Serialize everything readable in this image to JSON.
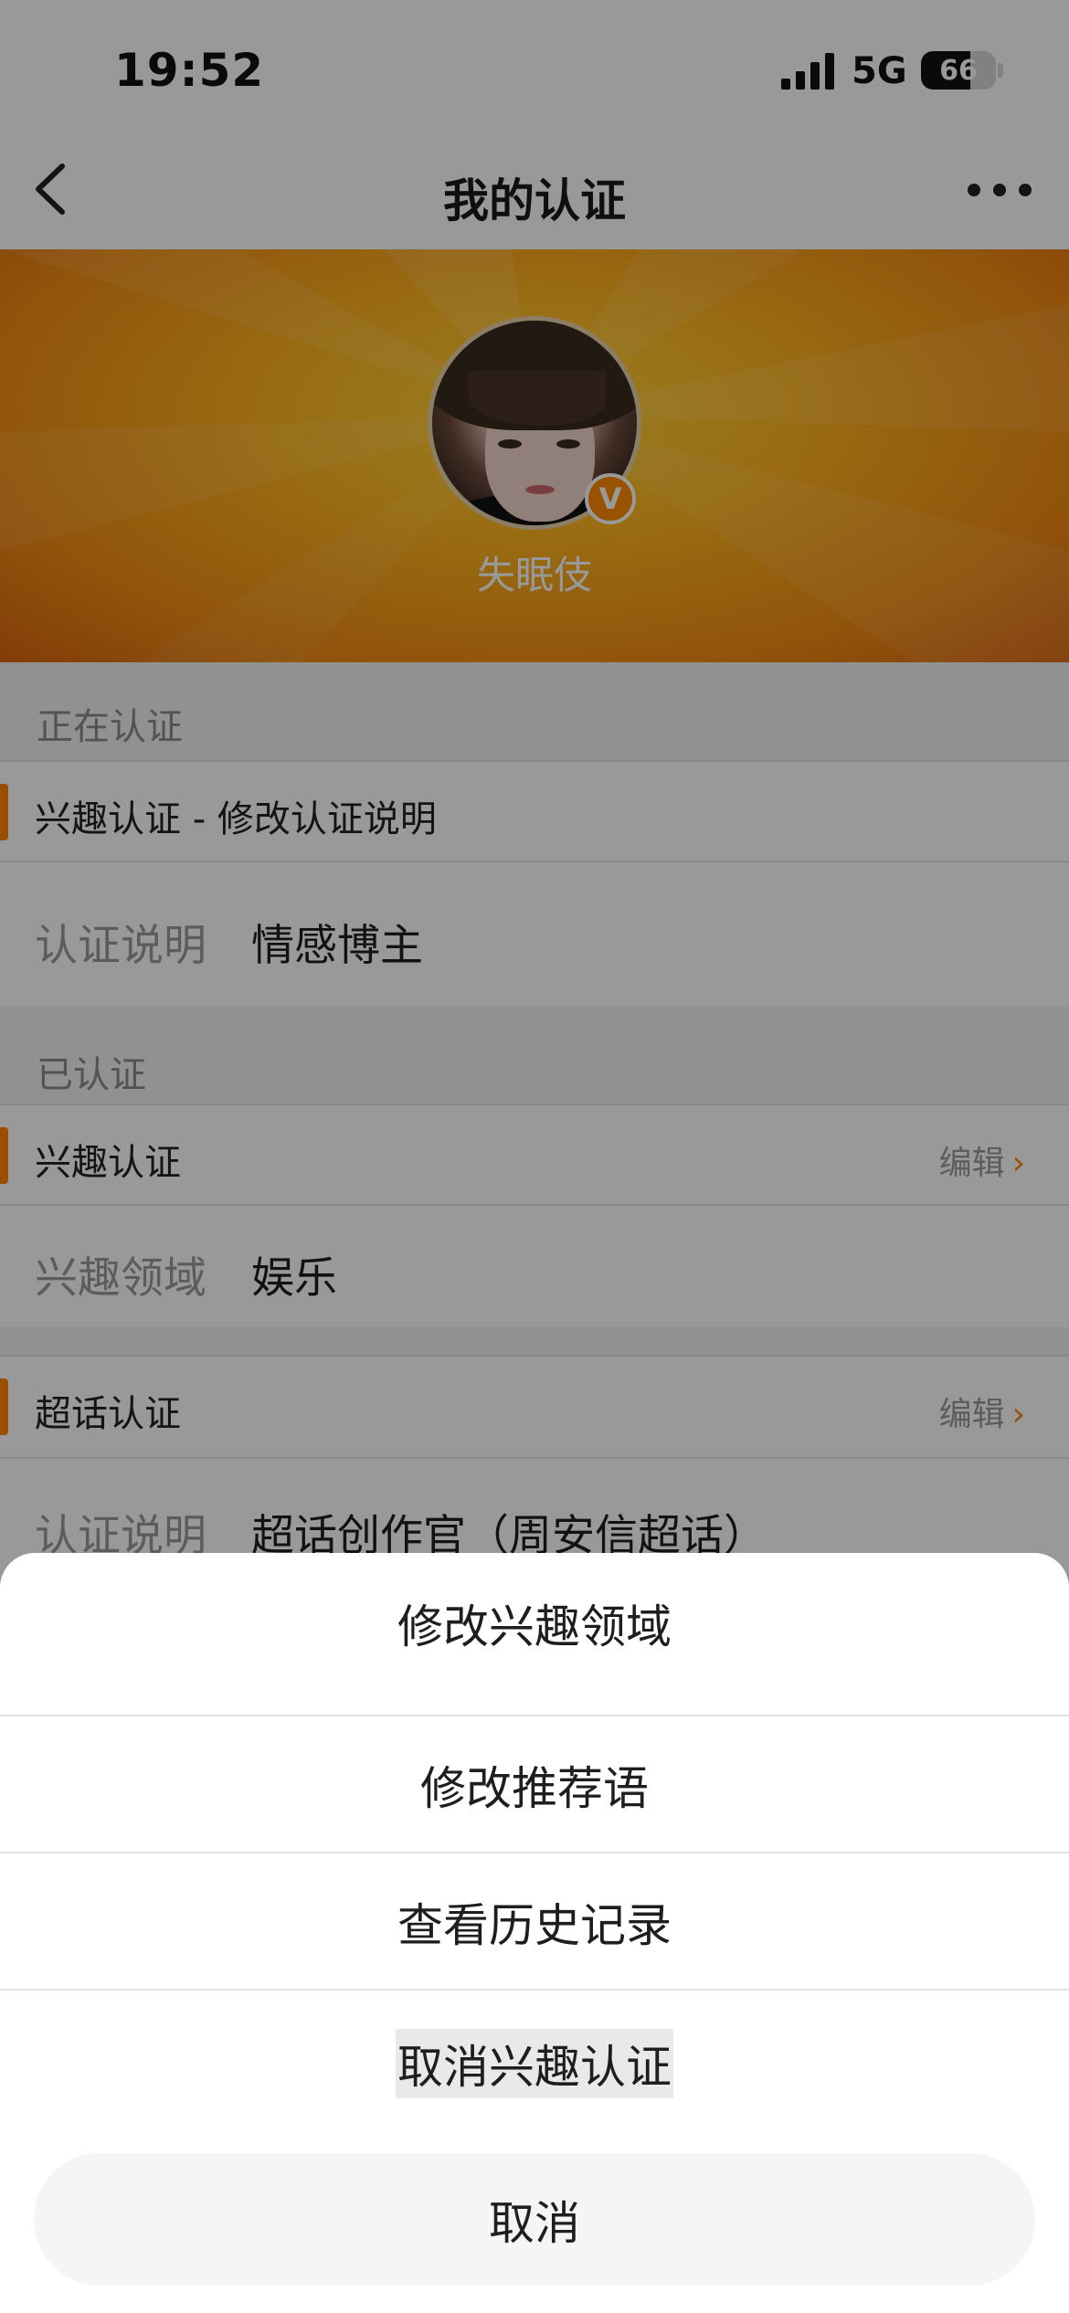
{
  "status_bar": {
    "time": "19:52",
    "network": "5G",
    "battery": "66",
    "battery_level": 0.66
  },
  "nav": {
    "title": "我的认证"
  },
  "profile": {
    "username": "失眠伎",
    "badge": "V"
  },
  "sections": {
    "pending": {
      "header": "正在认证",
      "title": "兴趣认证 - 修改认证说明",
      "label": "认证说明",
      "value": "情感博主"
    },
    "verified": {
      "header": "已认证",
      "interest": {
        "title": "兴趣认证",
        "edit": "编辑",
        "label": "兴趣领域",
        "value": "娱乐"
      },
      "supertopic": {
        "title": "超话认证",
        "edit": "编辑",
        "label": "认证说明",
        "value": "超话创作官（周安信超话）"
      }
    }
  },
  "action_sheet": {
    "items": [
      "修改兴趣领域",
      "修改推荐语",
      "查看历史记录",
      "取消兴趣认证"
    ],
    "cancel": "取消"
  },
  "colors": {
    "accent": "#ff8200",
    "banner": "#ffb51f"
  },
  "icons": [
    "back-icon",
    "more-icon",
    "signal-icon",
    "battery-icon",
    "verified-badge-icon",
    "chevron-right-icon"
  ]
}
